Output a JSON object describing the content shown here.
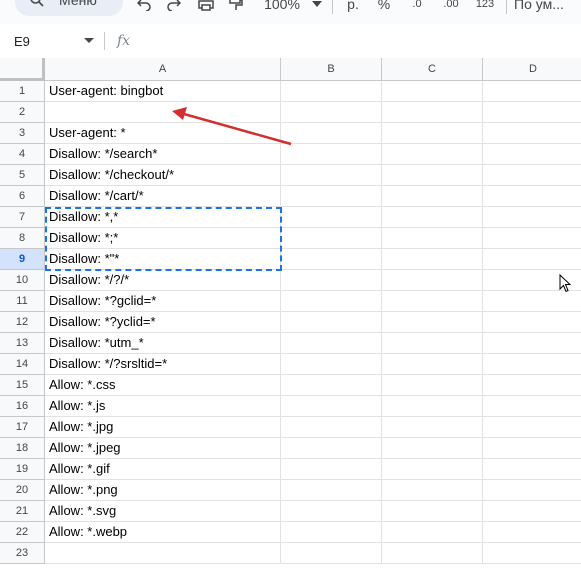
{
  "toolbar": {
    "menu_label": "Меню",
    "zoom": "100%",
    "currency": "р.",
    "percent": "%",
    "dec_decrease": ".0",
    "dec_increase": ".00",
    "number_format": "123",
    "font": "По ум..."
  },
  "formula_bar": {
    "name_box": "E9",
    "fx": "fx",
    "value": ""
  },
  "columns": [
    "A",
    "B",
    "C",
    "D"
  ],
  "rows": [
    {
      "num": "1",
      "a": "User-agent: bingbot"
    },
    {
      "num": "2",
      "a": ""
    },
    {
      "num": "3",
      "a": "User-agent: *"
    },
    {
      "num": "4",
      "a": "Disallow: */search*"
    },
    {
      "num": "5",
      "a": "Disallow: */checkout/*"
    },
    {
      "num": "6",
      "a": "Disallow: */cart/*"
    },
    {
      "num": "7",
      "a": "Disallow: *,*"
    },
    {
      "num": "8",
      "a": "Disallow: *;*"
    },
    {
      "num": "9",
      "a": "Disallow: *\"*"
    },
    {
      "num": "10",
      "a": "Disallow: */?/*"
    },
    {
      "num": "11",
      "a": "Disallow: *?gclid=*"
    },
    {
      "num": "12",
      "a": "Disallow: *?yclid=*"
    },
    {
      "num": "13",
      "a": "Disallow: *utm_*"
    },
    {
      "num": "14",
      "a": "Disallow: */?srsltid=*"
    },
    {
      "num": "15",
      "a": "Allow: *.css"
    },
    {
      "num": "16",
      "a": "Allow: *.js"
    },
    {
      "num": "17",
      "a": "Allow: *.jpg"
    },
    {
      "num": "18",
      "a": "Allow: *.jpeg"
    },
    {
      "num": "19",
      "a": "Allow: *.gif"
    },
    {
      "num": "20",
      "a": "Allow: *.png"
    },
    {
      "num": "21",
      "a": "Allow: *.svg"
    },
    {
      "num": "22",
      "a": "Allow: *.webp"
    },
    {
      "num": "23",
      "a": ""
    }
  ],
  "colors": {
    "selection": "#1a73e8",
    "annotation_arrow": "#d32f2f",
    "selected_row_header": "#d3e3fd"
  }
}
